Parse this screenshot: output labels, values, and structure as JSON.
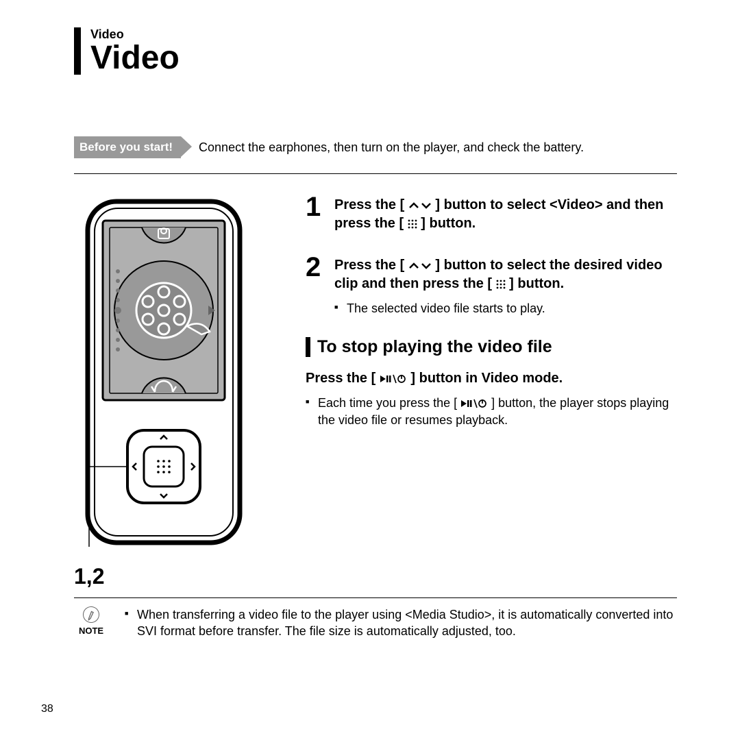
{
  "header": {
    "breadcrumb": "Video",
    "title": "Video"
  },
  "before": {
    "badge": "Before you start!",
    "text": "Connect the earphones, then turn on the player, and check the battery."
  },
  "steps": [
    {
      "num": "1",
      "pre": "Press the [ ",
      "mid": " ] button to select <Video> and then press the [ ",
      "post": " ] button."
    },
    {
      "num": "2",
      "pre": "Press the [ ",
      "mid": " ] button to select the desired video clip and then press the [ ",
      "post": " ] button.",
      "bullet": "The selected video file starts to play."
    }
  ],
  "subhead": "To stop playing the video file",
  "stop": {
    "pre": "Press the [ ",
    "post": " ] button in Video mode.",
    "bullet_pre": "Each time you press the [ ",
    "bullet_post": " ] button, the player stops playing the video file or resumes playback."
  },
  "callout": "1,2",
  "note": {
    "label": "NOTE",
    "text": "When transferring a video file to the player using <Media Studio>, it is automatically converted into SVI format before transfer. The file size is automatically adjusted, too."
  },
  "page": "38"
}
